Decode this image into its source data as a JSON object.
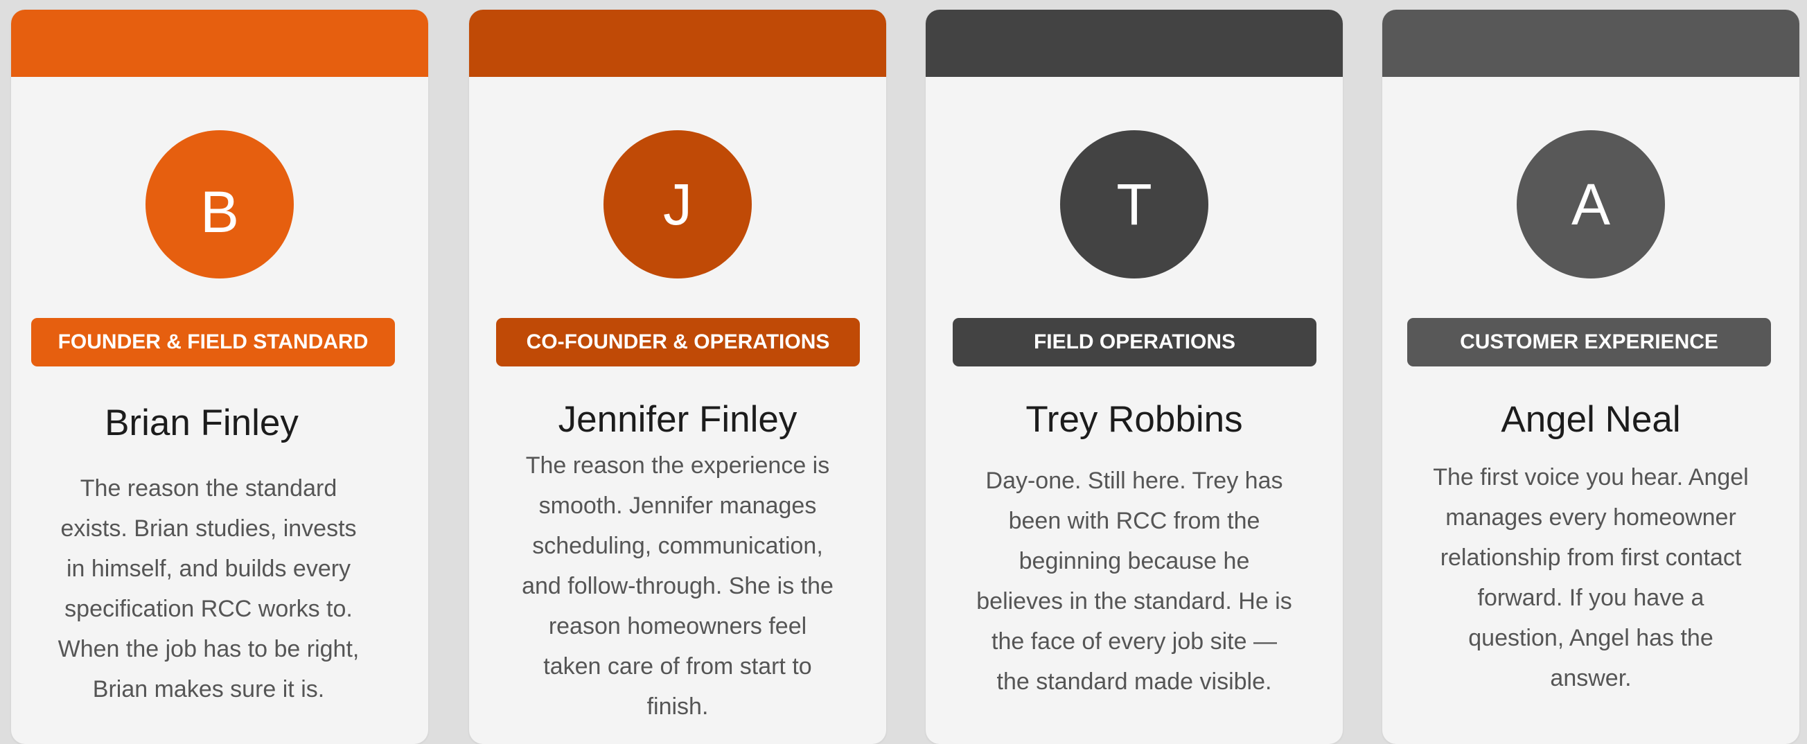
{
  "team": [
    {
      "initial": "B",
      "role": "FOUNDER & FIELD STANDARD",
      "name": "Brian Finley",
      "bio_lines": [
        "The reason the standard",
        "exists. Brian studies, invests",
        "in himself, and builds every",
        "specification RCC works to.",
        "When the job has to be right,",
        "Brian makes sure it is."
      ],
      "colors": {
        "bar": "#e65f0f",
        "avatar": "#e65f0f",
        "badge": "#e65f0f"
      }
    },
    {
      "initial": "J",
      "role": "CO-FOUNDER & OPERATIONS",
      "name": "Jennifer Finley",
      "bio_lines": [
        "The reason the experience is",
        "smooth. Jennifer manages",
        "scheduling, communication,",
        "and follow-through. She is the",
        "reason homeowners feel",
        "taken care of from start to",
        "finish."
      ],
      "colors": {
        "bar": "#c04a06",
        "avatar": "#c04a06",
        "badge": "#c04a06"
      }
    },
    {
      "initial": "T",
      "role": "FIELD OPERATIONS",
      "name": "Trey Robbins",
      "bio_lines": [
        "Day-one. Still here. Trey has",
        "been with RCC from the",
        "beginning because he",
        "believes in the standard. He is",
        "the face of every job site —",
        "the standard made visible."
      ],
      "colors": {
        "bar": "#434343",
        "avatar": "#434343",
        "badge": "#434343"
      }
    },
    {
      "initial": "A",
      "role": "CUSTOMER EXPERIENCE",
      "name": "Angel Neal",
      "bio_lines": [
        "The first voice you hear. Angel",
        "manages every homeowner",
        "relationship from first contact",
        "forward. If you have a",
        "question, Angel has the",
        "answer."
      ],
      "colors": {
        "bar": "#585858",
        "avatar": "#585858",
        "badge": "#585858"
      }
    }
  ]
}
